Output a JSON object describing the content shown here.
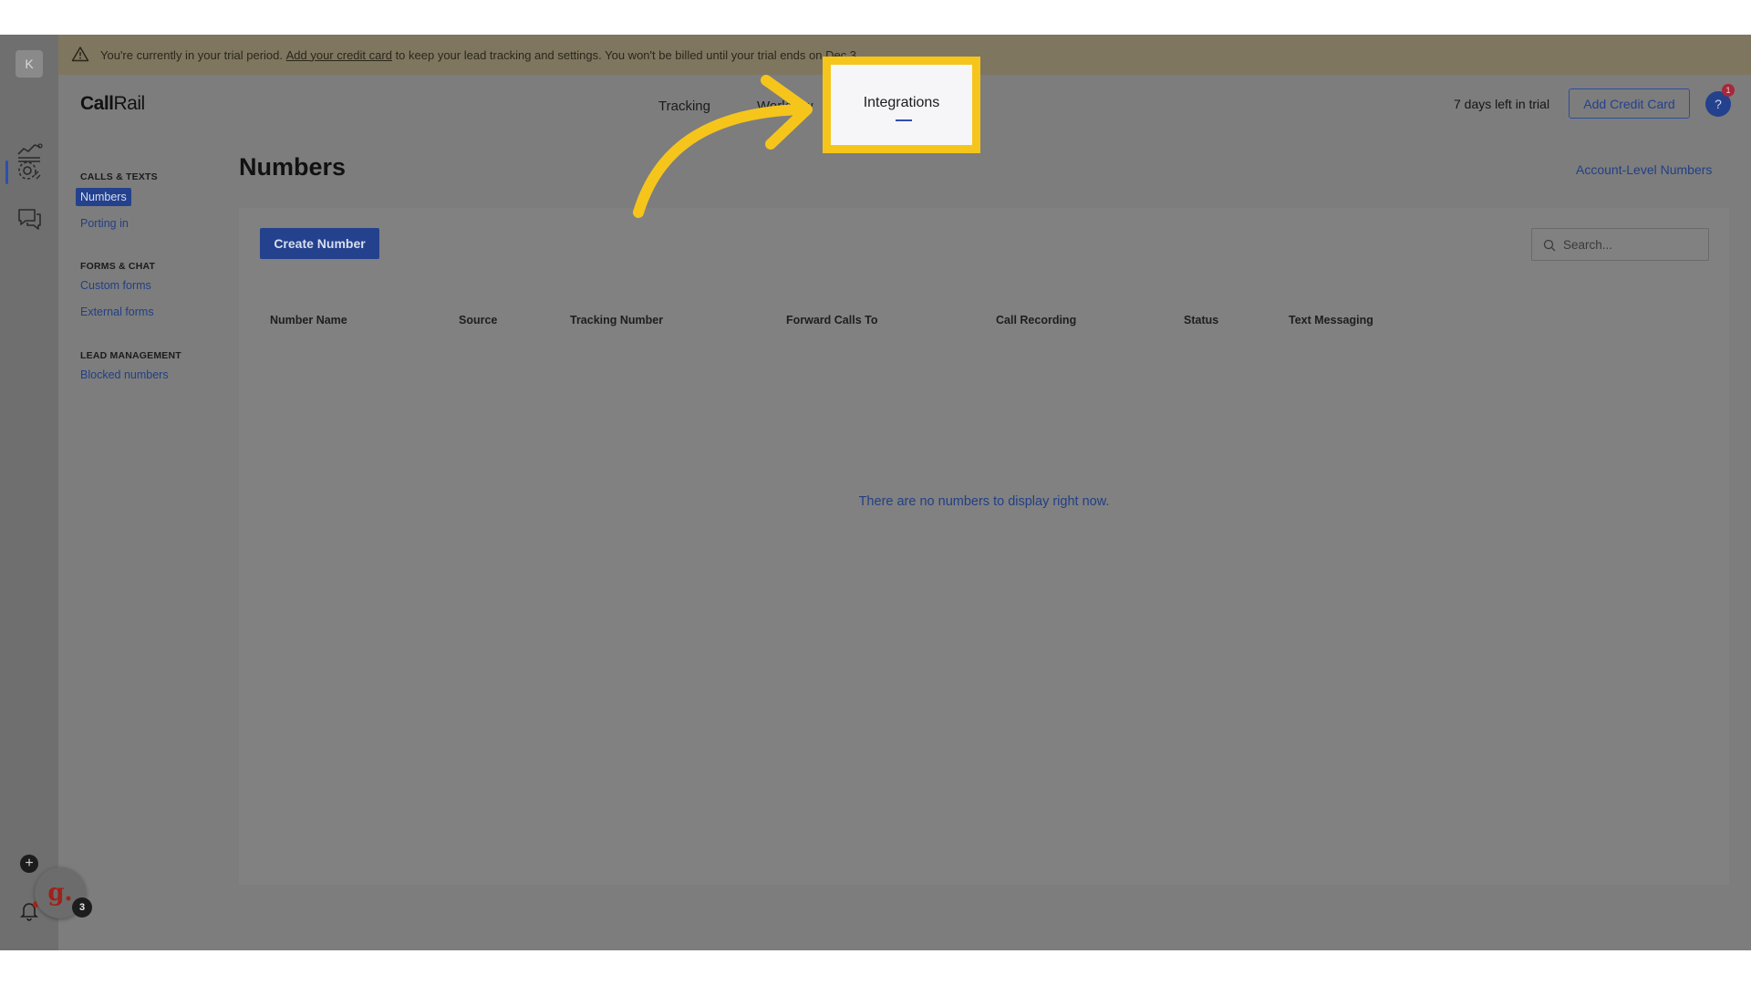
{
  "rail": {
    "avatar_initial": "K",
    "plus_label": "+",
    "g_logo": "g.",
    "g_badge_count": "3",
    "icons": [
      "analytics-icon",
      "settings-icon",
      "chat-icon",
      "bell-icon"
    ]
  },
  "banner": {
    "text_before": "You're currently in your trial period. ",
    "link": "Add your credit card",
    "text_after": " to keep your lead tracking and settings. You won't be billed until your trial ends on Dec 3."
  },
  "header": {
    "logo_call": "Call",
    "logo_rail": "Rail",
    "nav_tracking": "Tracking",
    "nav_workflow": "Workflow",
    "nav_integrations": "Integrations",
    "trial_text": "7 days left in trial",
    "add_credit_card": "Add Credit Card",
    "help_label": "?",
    "help_badge": "1"
  },
  "sidebar": {
    "section_calls": "CALLS & TEXTS",
    "numbers": "Numbers",
    "porting_in": "Porting in",
    "section_forms": "FORMS & CHAT",
    "custom_forms": "Custom forms",
    "external_forms": "External forms",
    "section_lead": "LEAD MANAGEMENT",
    "blocked_numbers": "Blocked numbers"
  },
  "main": {
    "title": "Numbers",
    "account_level_link": "Account-Level Numbers",
    "create_button": "Create Number",
    "search_placeholder": "Search...",
    "columns": [
      "Number Name",
      "Source",
      "Tracking Number",
      "Forward Calls To",
      "Call Recording",
      "Status",
      "Text Messaging"
    ],
    "empty_message": "There are no numbers to display right now."
  },
  "colors": {
    "highlight": "#f6c51c",
    "brand_blue": "#24418d",
    "overlay_gray": "#7d7d7d"
  }
}
